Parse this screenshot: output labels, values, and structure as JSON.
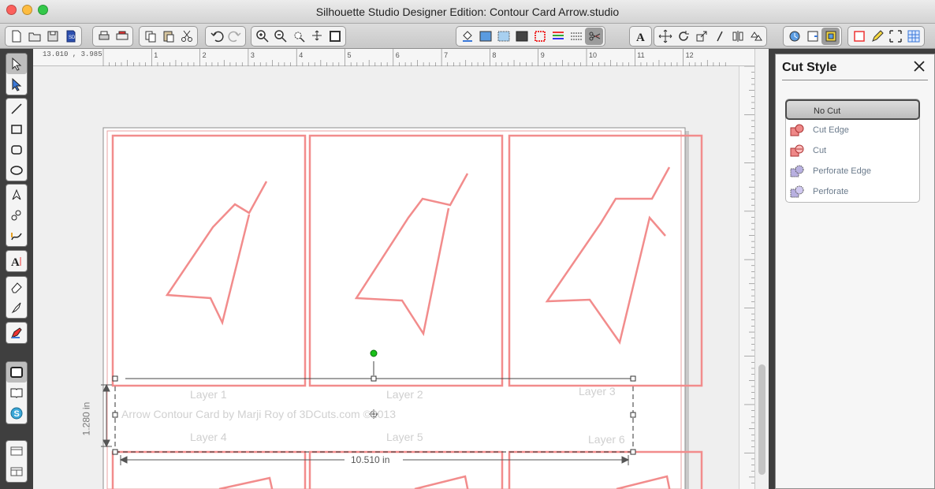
{
  "window": {
    "title": "Silhouette Studio Designer Edition: Contour Card Arrow.studio"
  },
  "ruler": {
    "coordinate": "13.010 , 3.985",
    "marks": [
      "0",
      "1",
      "2",
      "3",
      "4",
      "5",
      "6",
      "7",
      "8",
      "9",
      "10",
      "11",
      "12"
    ]
  },
  "canvas": {
    "layers": [
      "Layer 1",
      "Layer 2",
      "Layer 3",
      "Layer 4",
      "Layer 5",
      "Layer 6"
    ],
    "credit": "Arrow Contour Card by Marji Roy of 3DCuts.com ©2013",
    "width_label": "10.510 in",
    "height_label": "1.280 in"
  },
  "cut_style": {
    "title": "Cut Style",
    "options": [
      "No Cut",
      "Cut Edge",
      "Cut",
      "Perforate Edge",
      "Perforate"
    ],
    "selected": "No Cut"
  },
  "colors": {
    "cut_line": "#f28c8c",
    "accent_blue": "#3a78d8",
    "selection_green": "#19c019"
  }
}
